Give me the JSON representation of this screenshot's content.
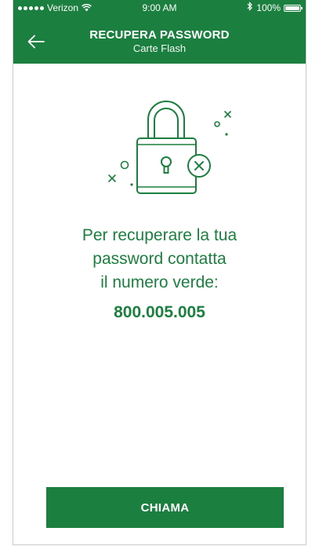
{
  "status_bar": {
    "carrier": "Verizon",
    "time": "9:00 AM",
    "battery": "100%"
  },
  "header": {
    "title": "RECUPERA PASSWORD",
    "subtitle": "Carte Flash"
  },
  "message": {
    "line1": "Per recuperare la tua",
    "line2": "password contatta",
    "line3": "il numero verde:",
    "phone": "800.005.005"
  },
  "actions": {
    "call_label": "CHIAMA"
  },
  "colors": {
    "brand_green": "#1b7f3f",
    "background": "#ffffff"
  },
  "icons": [
    "back-arrow-icon",
    "padlock-icon",
    "keyhole-icon",
    "x-circle-icon",
    "wifi-icon",
    "bluetooth-icon",
    "battery-icon"
  ]
}
